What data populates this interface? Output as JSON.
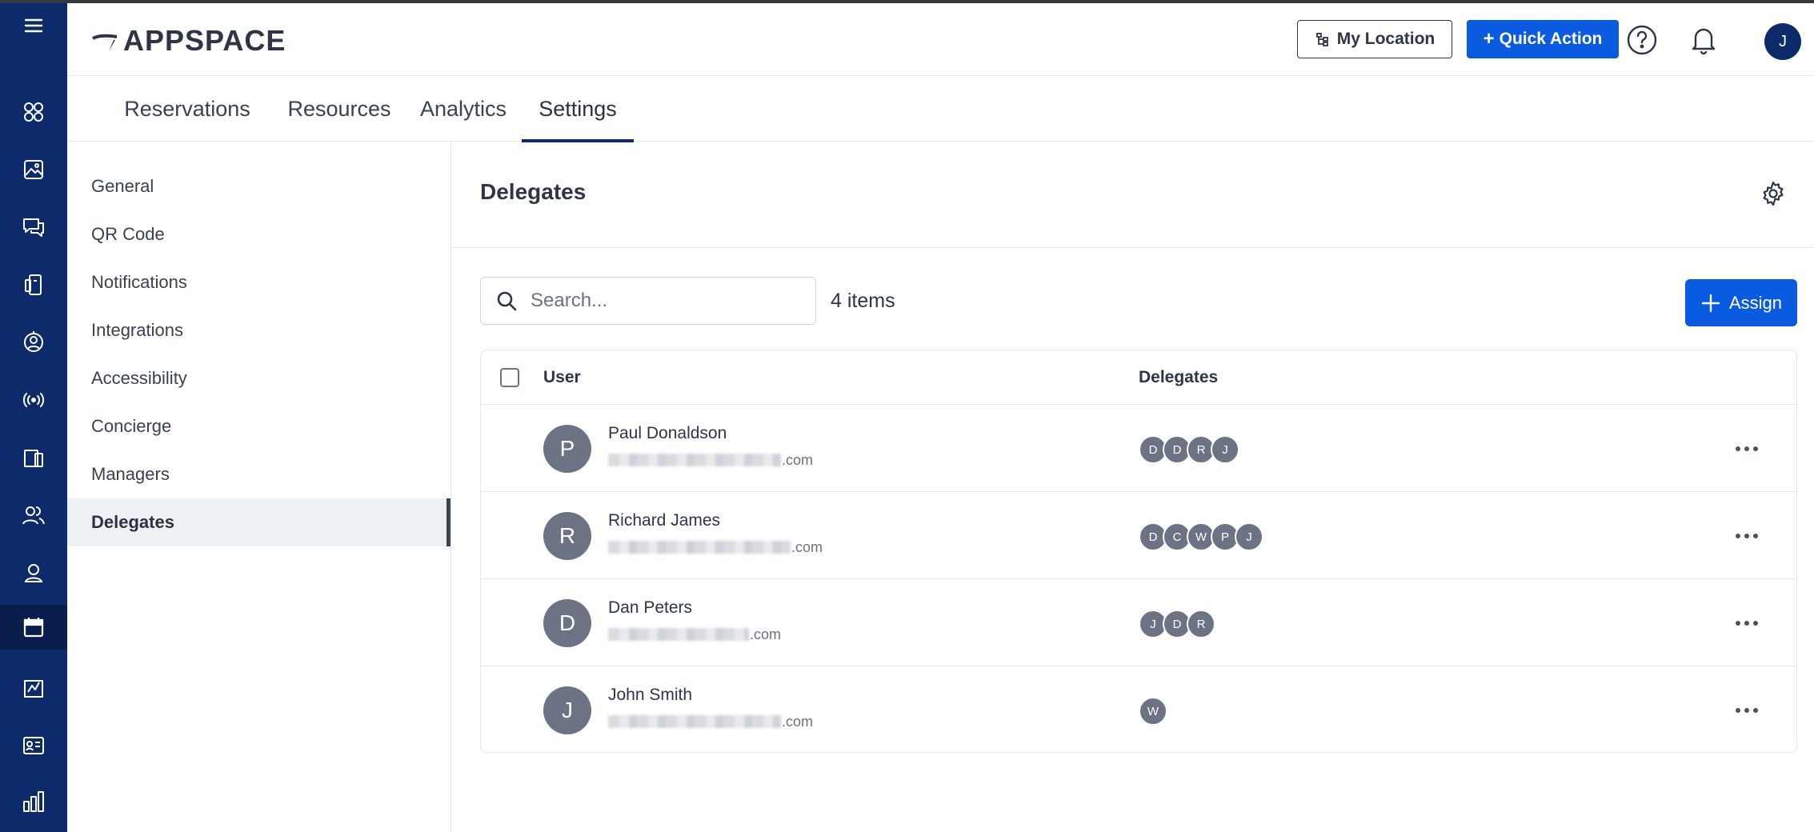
{
  "header": {
    "logo": "APPSPACE",
    "my_location_label": "My Location",
    "quick_action_label": "Quick Action",
    "user_initial": "J"
  },
  "rail": {
    "items": [
      {
        "icon": "menu-icon"
      },
      {
        "icon": "dashboard-grid-icon"
      },
      {
        "icon": "image-icon"
      },
      {
        "icon": "chat-icon"
      },
      {
        "icon": "device-icon"
      },
      {
        "icon": "location-person-icon"
      },
      {
        "icon": "broadcast-icon"
      },
      {
        "icon": "desk-icon"
      },
      {
        "icon": "people-icon"
      },
      {
        "icon": "user-badge-icon"
      },
      {
        "icon": "calendar-icon",
        "active": true
      },
      {
        "icon": "visitor-icon"
      },
      {
        "icon": "id-card-icon"
      },
      {
        "icon": "bar-chart-icon"
      }
    ]
  },
  "tabs": [
    {
      "label": "Reservations"
    },
    {
      "label": "Resources"
    },
    {
      "label": "Analytics"
    },
    {
      "label": "Settings",
      "active": true
    }
  ],
  "sidenav": {
    "items": [
      {
        "label": "General"
      },
      {
        "label": "QR Code"
      },
      {
        "label": "Notifications"
      },
      {
        "label": "Integrations"
      },
      {
        "label": "Accessibility"
      },
      {
        "label": "Concierge"
      },
      {
        "label": "Managers"
      },
      {
        "label": "Delegates",
        "active": true
      }
    ]
  },
  "main": {
    "title": "Delegates",
    "search_placeholder": "Search...",
    "item_count": "4 items",
    "assign_label": "Assign",
    "columns": {
      "user": "User",
      "delegates": "Delegates"
    },
    "rows": [
      {
        "initial": "P",
        "name": "Paul Donaldson",
        "email_suffix": ".com",
        "delegates": [
          "D",
          "D",
          "R",
          "J"
        ]
      },
      {
        "initial": "R",
        "name": "Richard James",
        "email_suffix": ".com",
        "delegates": [
          "D",
          "C",
          "W",
          "P",
          "J"
        ]
      },
      {
        "initial": "D",
        "name": "Dan Peters",
        "email_suffix": ".com",
        "delegates": [
          "J",
          "D",
          "R"
        ]
      },
      {
        "initial": "J",
        "name": "John Smith",
        "email_suffix": ".com",
        "delegates": [
          "W"
        ]
      }
    ]
  },
  "colors": {
    "rail_bg": "#0d2b6b",
    "primary": "#0b5be1",
    "avatar_gray": "#6b7385"
  }
}
